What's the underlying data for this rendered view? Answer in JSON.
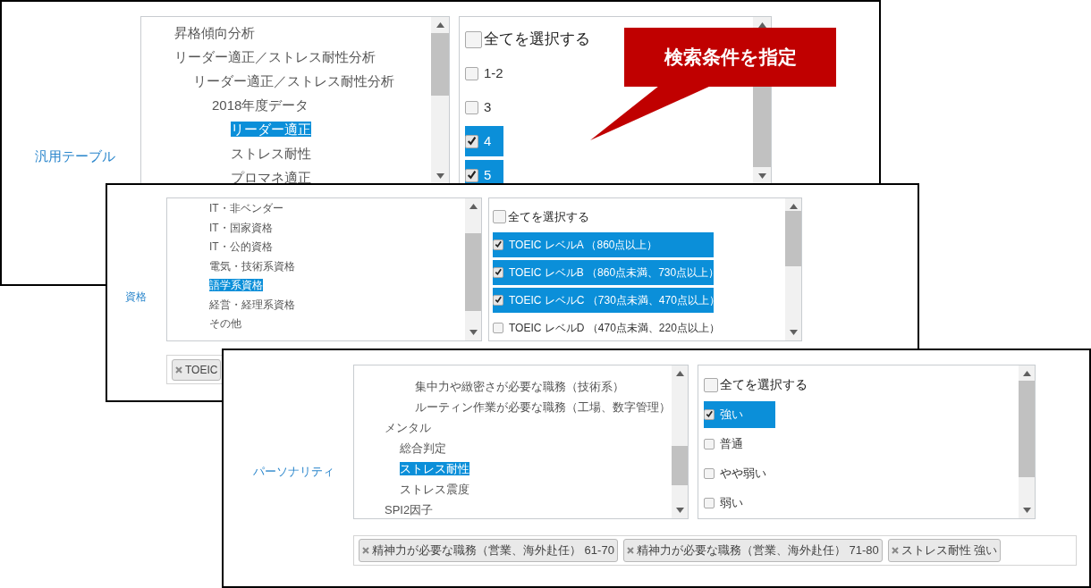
{
  "panels": [
    {
      "label": "汎用テーブル",
      "tree": [
        {
          "label": "昇格傾向分析",
          "selected": false
        },
        {
          "label": "リーダー適正／ストレス耐性分析",
          "selected": false,
          "children": [
            {
              "label": "リーダー適正／ストレス耐性分析",
              "selected": false,
              "children": [
                {
                  "label": "2018年度データ",
                  "selected": false,
                  "children": [
                    {
                      "label": "リーダー適正",
                      "selected": true
                    },
                    {
                      "label": "ストレス耐性",
                      "selected": false
                    },
                    {
                      "label": "プロマネ適正",
                      "selected": false
                    }
                  ]
                }
              ]
            }
          ]
        }
      ],
      "select_all": {
        "label": "全てを選択する",
        "checked": false
      },
      "options": [
        {
          "label": "1-2",
          "checked": false
        },
        {
          "label": "3",
          "checked": false
        },
        {
          "label": "4",
          "checked": true
        },
        {
          "label": "5",
          "checked": true
        }
      ]
    },
    {
      "label": "資格",
      "tree": [
        {
          "label": "IT・非ベンダー",
          "selected": false
        },
        {
          "label": "IT・国家資格",
          "selected": false
        },
        {
          "label": "IT・公的資格",
          "selected": false
        },
        {
          "label": "電気・技術系資格",
          "selected": false
        },
        {
          "label": "語学系資格",
          "selected": true
        },
        {
          "label": "経営・経理系資格",
          "selected": false
        },
        {
          "label": "その他",
          "selected": false
        }
      ],
      "select_all": {
        "label": "全てを選択する",
        "checked": false
      },
      "options": [
        {
          "label": "TOEIC レベルA （860点以上）",
          "checked": true
        },
        {
          "label": "TOEIC レベルB （860点未満、730点以上）",
          "checked": true
        },
        {
          "label": "TOEIC レベルC （730点未満、470点以上）",
          "checked": true
        },
        {
          "label": "TOEIC レベルD （470点未満、220点以上）",
          "checked": false
        }
      ],
      "tags": [
        "TOEIC"
      ]
    },
    {
      "label": "パーソナリティ",
      "tree": [
        {
          "children": [
            {
              "children": [
                {
                  "label": "集中力や緻密さが必要な職務（技術系）",
                  "selected": false
                },
                {
                  "label": "ルーティン作業が必要な職務（工場、数字管理）",
                  "selected": false
                }
              ]
            }
          ]
        },
        {
          "label": "メンタル",
          "selected": false,
          "children": [
            {
              "label": "総合判定",
              "selected": false
            },
            {
              "label": "ストレス耐性",
              "selected": true
            },
            {
              "label": "ストレス震度",
              "selected": false
            }
          ]
        },
        {
          "label": "SPI2因子",
          "selected": false
        }
      ],
      "select_all": {
        "label": "全てを選択する",
        "checked": false
      },
      "options": [
        {
          "label": "強い",
          "checked": true
        },
        {
          "label": "普通",
          "checked": false
        },
        {
          "label": "やや弱い",
          "checked": false
        },
        {
          "label": "弱い",
          "checked": false
        }
      ],
      "tags": [
        "精神力が必要な職務（営業、海外赴任） 61-70",
        "精神力が必要な職務（営業、海外赴任） 71-80",
        "ストレス耐性 強い"
      ]
    }
  ],
  "callout": {
    "text": "検索条件を指定"
  }
}
